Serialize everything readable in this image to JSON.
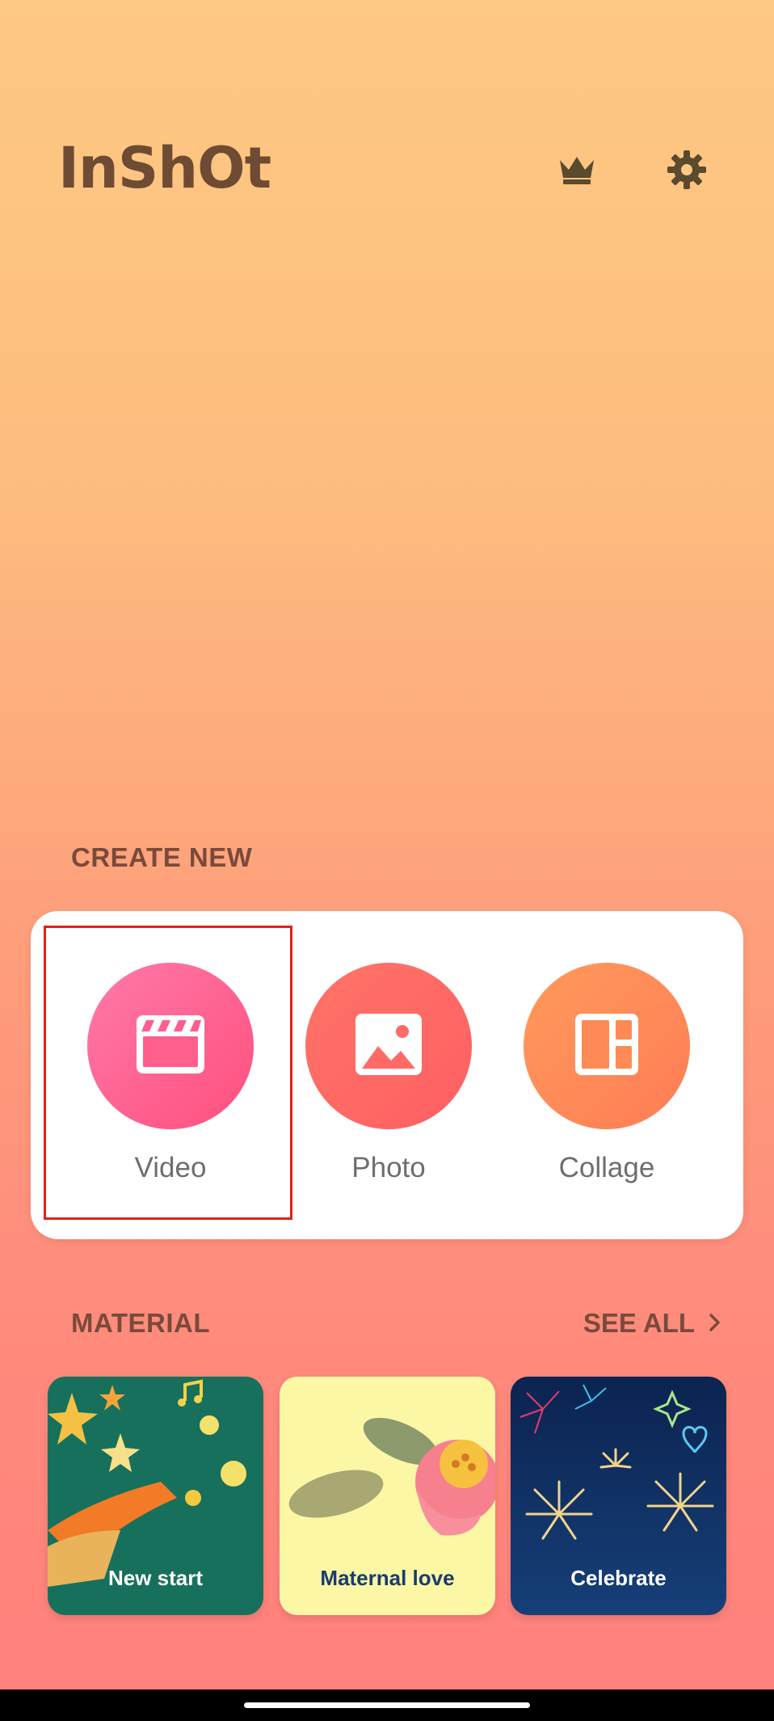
{
  "app": {
    "logo": "InShOt"
  },
  "top_actions": {
    "crown_icon": "crown-icon",
    "settings_icon": "gear-icon"
  },
  "create_new": {
    "title": "CREATE NEW",
    "items": [
      {
        "label": "Video",
        "icon": "clapperboard-icon",
        "color": "#ff5a8a"
      },
      {
        "label": "Photo",
        "icon": "image-icon",
        "color": "#ff6a66"
      },
      {
        "label": "Collage",
        "icon": "collage-layout-icon",
        "color": "#ff8a55"
      }
    ]
  },
  "material": {
    "title": "MATERIAL",
    "see_all": "SEE ALL",
    "items": [
      {
        "label": "New start",
        "color": "#17705c"
      },
      {
        "label": "Maternal love",
        "color": "#fbf7a5"
      },
      {
        "label": "Celebrate",
        "color": "#0b2350"
      }
    ]
  },
  "colors": {
    "accent_text": "#7a4a3a",
    "highlight_border": "#e02020"
  }
}
